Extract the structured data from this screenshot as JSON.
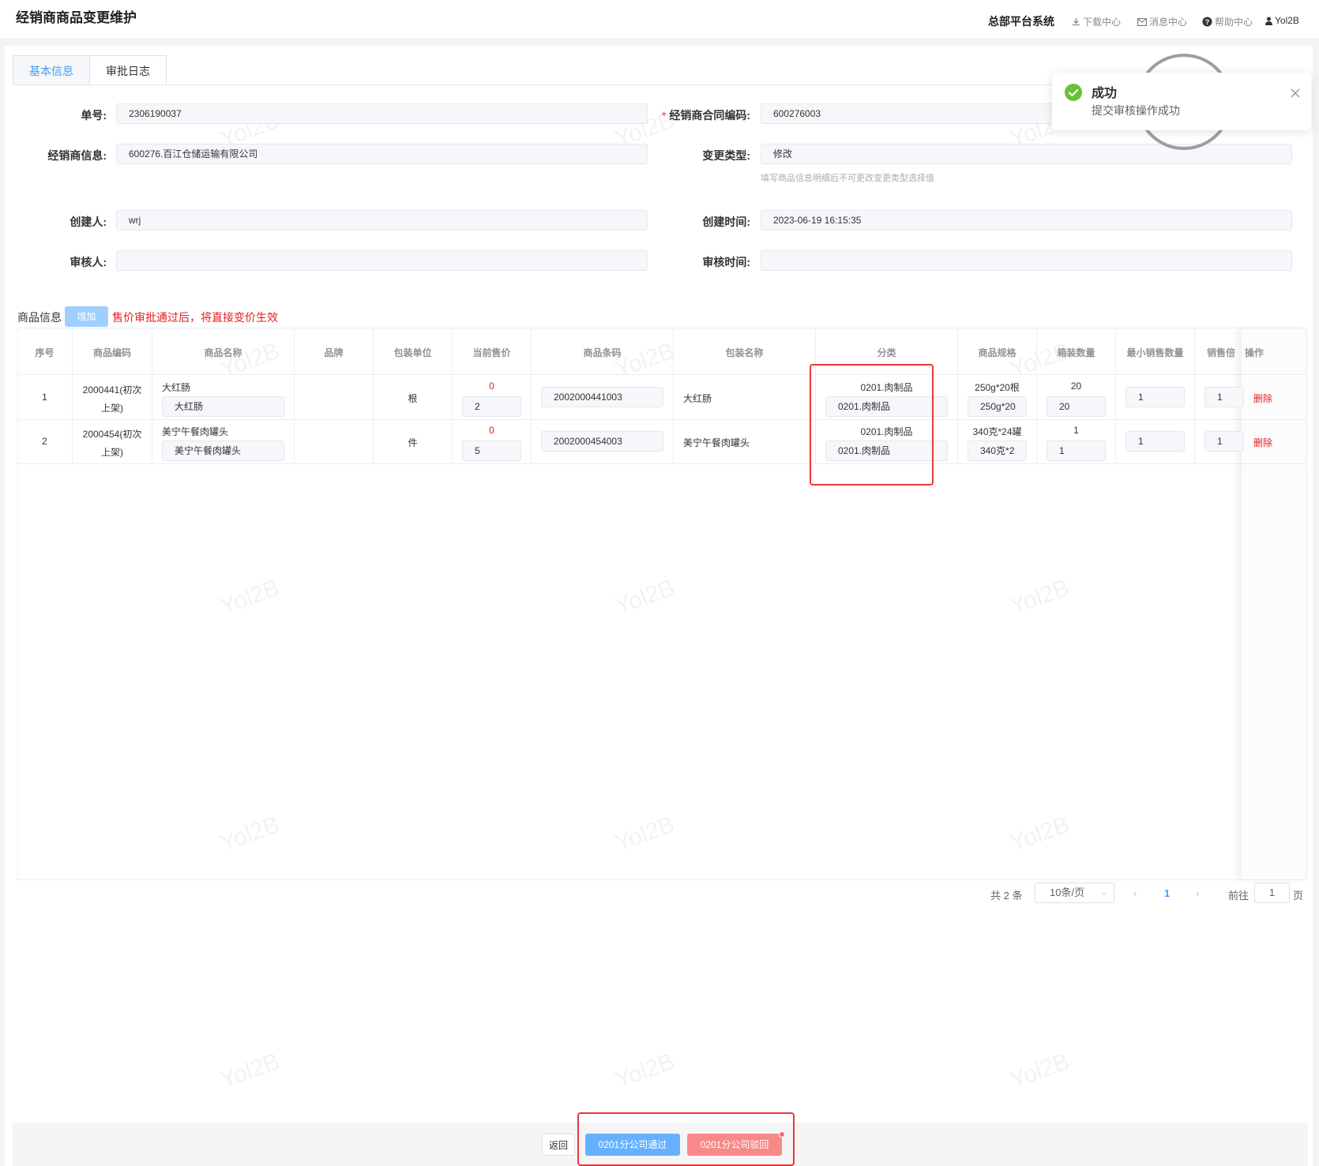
{
  "header": {
    "title": "经销商商品变更维护",
    "system": "总部平台系统",
    "links": [
      {
        "label": "下载中心",
        "icon": "download-icon"
      },
      {
        "label": "消息中心",
        "icon": "mail-icon"
      },
      {
        "label": "帮助中心",
        "icon": "help-icon"
      }
    ],
    "user": "Yol2B",
    "user_icon": "user-icon"
  },
  "tabs": [
    "基本信息",
    "审批日志"
  ],
  "form": {
    "order_no": {
      "label": "单号:",
      "value": "2306190037"
    },
    "contract_no": {
      "label": "经销商合同编码:",
      "value": "600276003"
    },
    "dealer_info": {
      "label": "经销商信息:",
      "value": "600276.百江仓储运输有限公司"
    },
    "change_type": {
      "label": "变更类型:",
      "value": "修改",
      "hint": "填写商品信息明细后不可更改变更类型选择值"
    },
    "creator": {
      "label": "创建人:",
      "value": "wrj"
    },
    "create_time": {
      "label": "创建时间:",
      "value": "2023-06-19 16:15:35"
    },
    "reviewer": {
      "label": "审核人:",
      "value": ""
    },
    "review_time": {
      "label": "审核时间:",
      "value": ""
    }
  },
  "goods": {
    "section_label": "商品信息",
    "add_label": "增加",
    "warning": "售价审批通过后，将直接变价生效",
    "columns": [
      "序号",
      "商品编码",
      "商品名称",
      "品牌",
      "包装单位",
      "当前售价",
      "商品条码",
      "包装名称",
      "分类",
      "商品规格",
      "箱装数量",
      "最小销售数量",
      "销售倍",
      "操作"
    ],
    "rows": [
      {
        "seq": "1",
        "code_line1": "2000441(初次",
        "code_line2": "上架)",
        "name_text": "大红肠",
        "name_input": "大红肠",
        "brand": "",
        "unit": "根",
        "price_current": "0",
        "price_input": "2",
        "barcode": "2002000441003",
        "pack_name": "大红肠",
        "category_text": "0201.肉制品",
        "category_select": "0201.肉制品",
        "spec_text": "250g*20根",
        "spec_input": "250g*20",
        "box_qty_text": "20",
        "box_qty_input": "20",
        "min_qty": "1",
        "multiple": "1",
        "action": "删除"
      },
      {
        "seq": "2",
        "code_line1": "2000454(初次",
        "code_line2": "上架)",
        "name_text": "美宁午餐肉罐头",
        "name_input": "美宁午餐肉罐头",
        "brand": "",
        "unit": "件",
        "price_current": "0",
        "price_input": "5",
        "barcode": "2002000454003",
        "pack_name": "美宁午餐肉罐头",
        "category_text": "0201.肉制品",
        "category_select": "0201.肉制品",
        "spec_text": "340克*24罐",
        "spec_input": "340克*2",
        "box_qty_text": "1",
        "box_qty_input": "1",
        "min_qty": "1",
        "multiple": "1",
        "action": "删除"
      }
    ]
  },
  "pagination": {
    "total": "共 2 条",
    "page_size": "10条/页",
    "current": "1",
    "goto_label": "前往",
    "goto_value": "1",
    "page_suffix": "页"
  },
  "footer": {
    "back": "返回",
    "pass": "0201分公司通过",
    "reject": "0201分公司驳回"
  },
  "notification": {
    "title": "成功",
    "message": "提交审核操作成功",
    "icon": "success-check-icon",
    "close_icon": "close-icon"
  },
  "watermark": "Yol2B",
  "colors": {
    "primary": "#409eff",
    "danger": "#e61e1e",
    "success": "#67c23a",
    "highlight_box": "#e8383d"
  }
}
